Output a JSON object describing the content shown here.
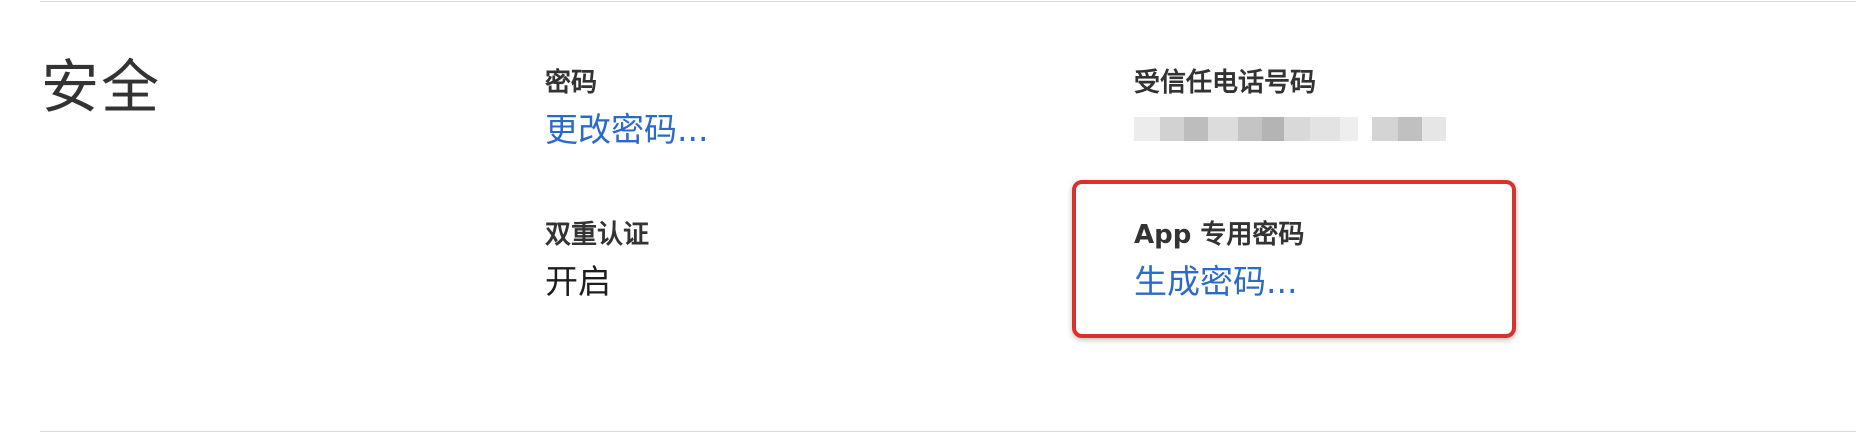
{
  "section": {
    "title": "安全"
  },
  "password": {
    "label": "密码",
    "link": "更改密码..."
  },
  "two_factor": {
    "label": "双重认证",
    "value": "开启"
  },
  "trusted_phone": {
    "label": "受信任电话号码",
    "value_masked": true
  },
  "app_password": {
    "label": "App 专用密码",
    "link": "生成密码..."
  },
  "colors": {
    "link": "#2a6acb",
    "highlight": "#d9322c",
    "text": "#333333",
    "divider": "#d8d8d8"
  }
}
